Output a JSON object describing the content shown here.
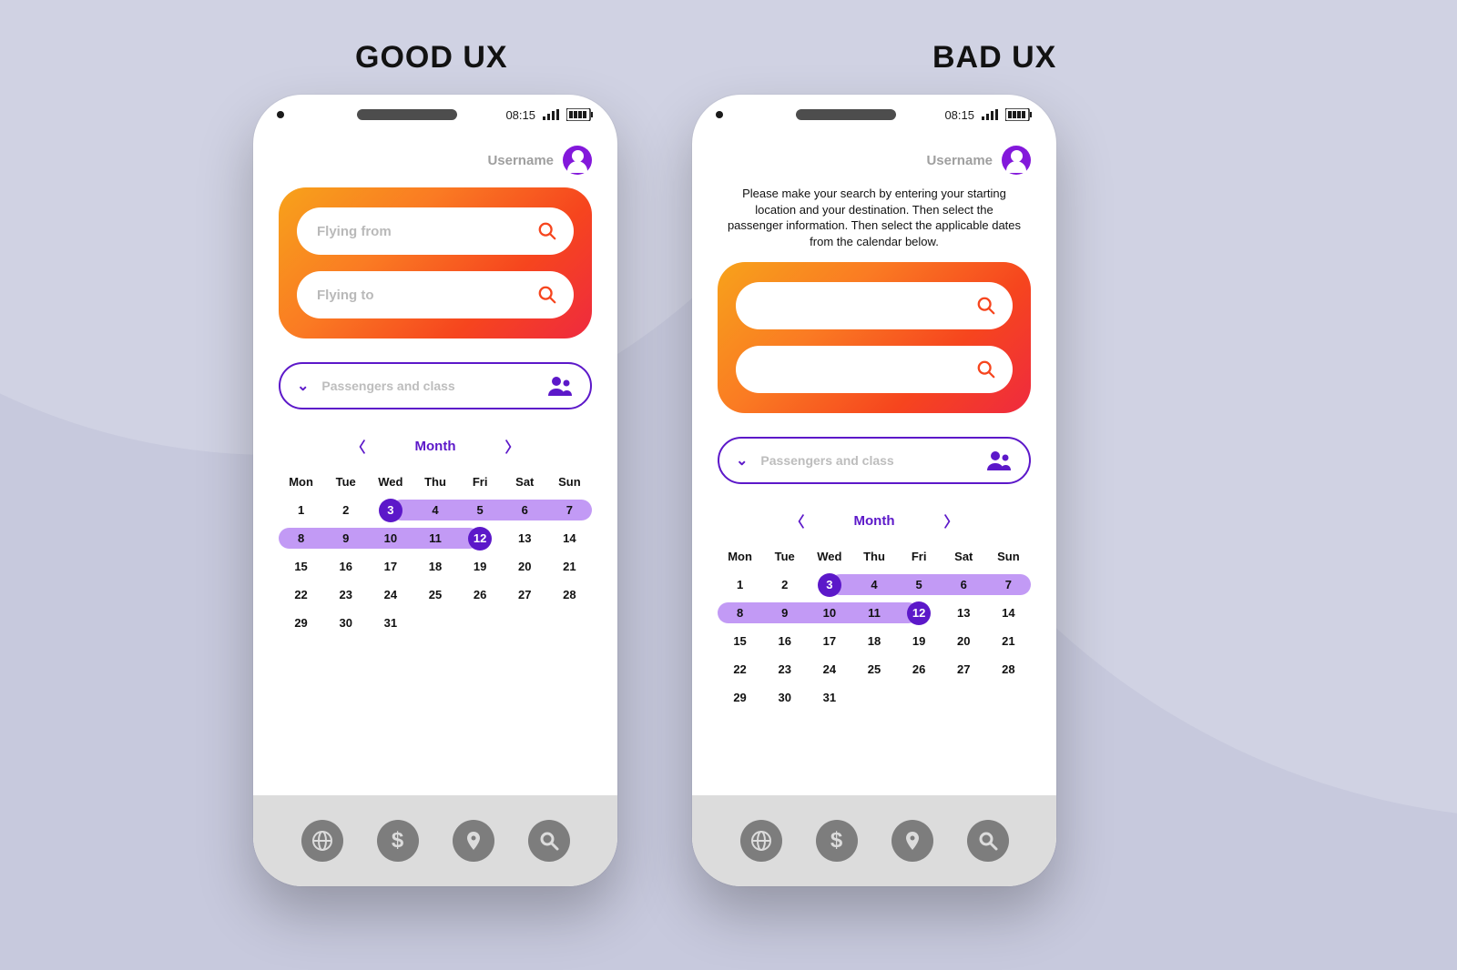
{
  "titles": {
    "good": "GOOD UX",
    "bad": "BAD UX"
  },
  "status": {
    "time": "08:15"
  },
  "user": {
    "name": "Username"
  },
  "bad_instructions": "Please make your search by entering your starting location and your destination. Then select the passenger information. Then select the applicable dates from the calendar below.",
  "search": {
    "from_placeholder": "Flying from",
    "to_placeholder": "Flying to"
  },
  "pax": {
    "label": "Passengers and class"
  },
  "calendar": {
    "month_label": "Month",
    "dow": [
      "Mon",
      "Tue",
      "Wed",
      "Thu",
      "Fri",
      "Sat",
      "Sun"
    ],
    "days": [
      1,
      2,
      3,
      4,
      5,
      6,
      7,
      8,
      9,
      10,
      11,
      12,
      13,
      14,
      15,
      16,
      17,
      18,
      19,
      20,
      21,
      22,
      23,
      24,
      25,
      26,
      27,
      28,
      29,
      30,
      31
    ],
    "range_start": 3,
    "range_end": 12
  },
  "colors": {
    "accent_purple": "#5c18c9",
    "range_purple": "#c29af5",
    "gradient_from": "#f7a21b",
    "gradient_to": "#ef2a3f"
  }
}
